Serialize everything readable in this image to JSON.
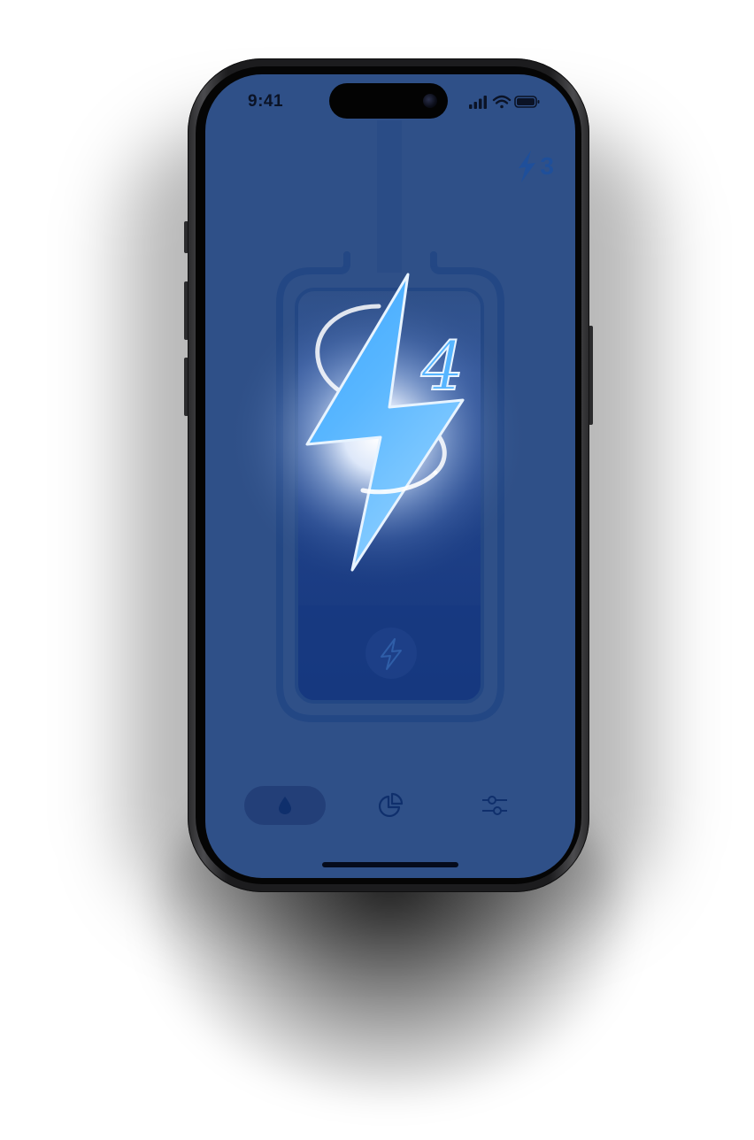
{
  "status_bar": {
    "time": "9:41",
    "icons": [
      "cellular-signal-icon",
      "wifi-icon",
      "battery-icon"
    ]
  },
  "header": {
    "badge_count": "3",
    "badge_icon": "bolt-icon"
  },
  "hero": {
    "level_number": "4",
    "icon": "lightning-bolt-icon",
    "container_icon": "battery-cell-icon",
    "button_icon": "bolt-button-icon"
  },
  "tabbar": {
    "items": [
      {
        "name": "drop-icon",
        "active": true
      },
      {
        "name": "pie-chart-icon",
        "active": false
      },
      {
        "name": "sliders-icon",
        "active": false
      }
    ]
  },
  "colors": {
    "screen_bg": "#2f5088",
    "accent": "#49b2ff",
    "dark_accent": "#1f4f9a",
    "frame": "#1c1c1e"
  }
}
